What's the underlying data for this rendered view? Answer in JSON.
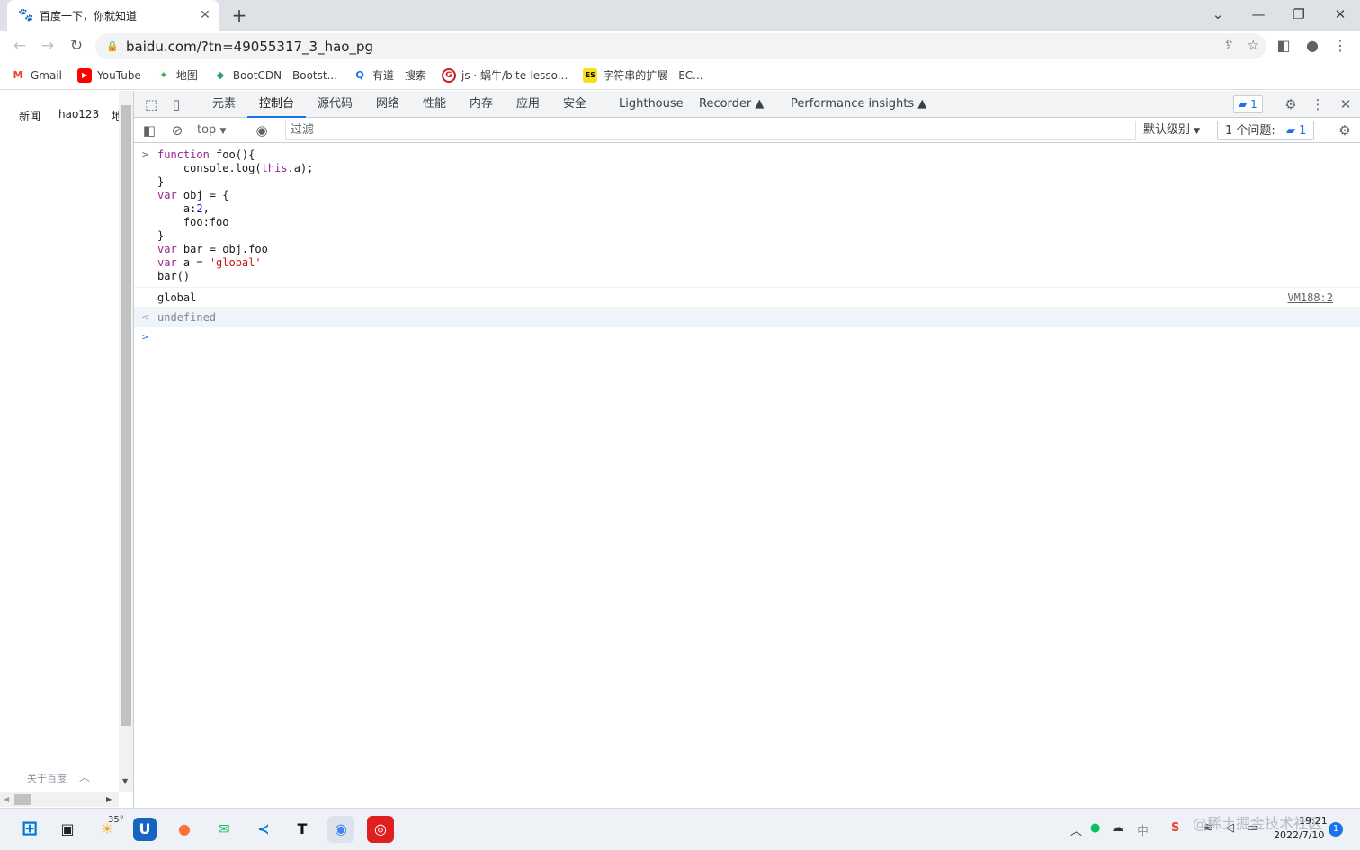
{
  "browser": {
    "tab_title": "百度一下，你就知道",
    "new_tab": "+",
    "url": "baidu.com/?tn=49055317_3_hao_pg"
  },
  "bookmarks": [
    {
      "label": "Gmail",
      "icon": "gmail-icon",
      "color": "#ea4335",
      "glyph": "M"
    },
    {
      "label": "YouTube",
      "icon": "youtube-icon",
      "color": "#ff0000",
      "glyph": "▶"
    },
    {
      "label": "地图",
      "icon": "maps-icon",
      "color": "#34a853",
      "glyph": "✦"
    },
    {
      "label": "BootCDN - Bootst...",
      "icon": "bootcdn-icon",
      "color": "#2aa36b",
      "glyph": "◆"
    },
    {
      "label": "有道 - 搜索",
      "icon": "youdao-search-icon",
      "color": "#1a73e8",
      "glyph": "Q"
    },
    {
      "label": "js · 蜗牛/bite-lesso...",
      "icon": "gitee-icon",
      "color": "#c71d23",
      "glyph": "G"
    },
    {
      "label": "字符串的扩展 - EC...",
      "icon": "es6-icon",
      "color": "#f7df1e",
      "glyph": "ES"
    }
  ],
  "page": {
    "nav": [
      "新闻",
      "hao123",
      "地"
    ],
    "about": "关于百度"
  },
  "devtools": {
    "tabs": [
      "元素",
      "控制台",
      "源代码",
      "网络",
      "性能",
      "内存",
      "应用",
      "安全",
      "Lighthouse",
      "Recorder ▲",
      "Performance insights ▲"
    ],
    "active_tab": "控制台",
    "messages_badge": "1",
    "context": "top",
    "filter_placeholder": "过滤",
    "levels": "默认级别",
    "issues_label": "1 个问题:",
    "issues_count": "1",
    "console_output": "global",
    "console_source": "VM188:2",
    "return_value": "undefined"
  },
  "taskbar": {
    "weather": "35°",
    "time": "19:21",
    "date": "2022/7/10",
    "notifications": "1",
    "watermark": "@稀土掘金技术社区",
    "ime": "中"
  }
}
